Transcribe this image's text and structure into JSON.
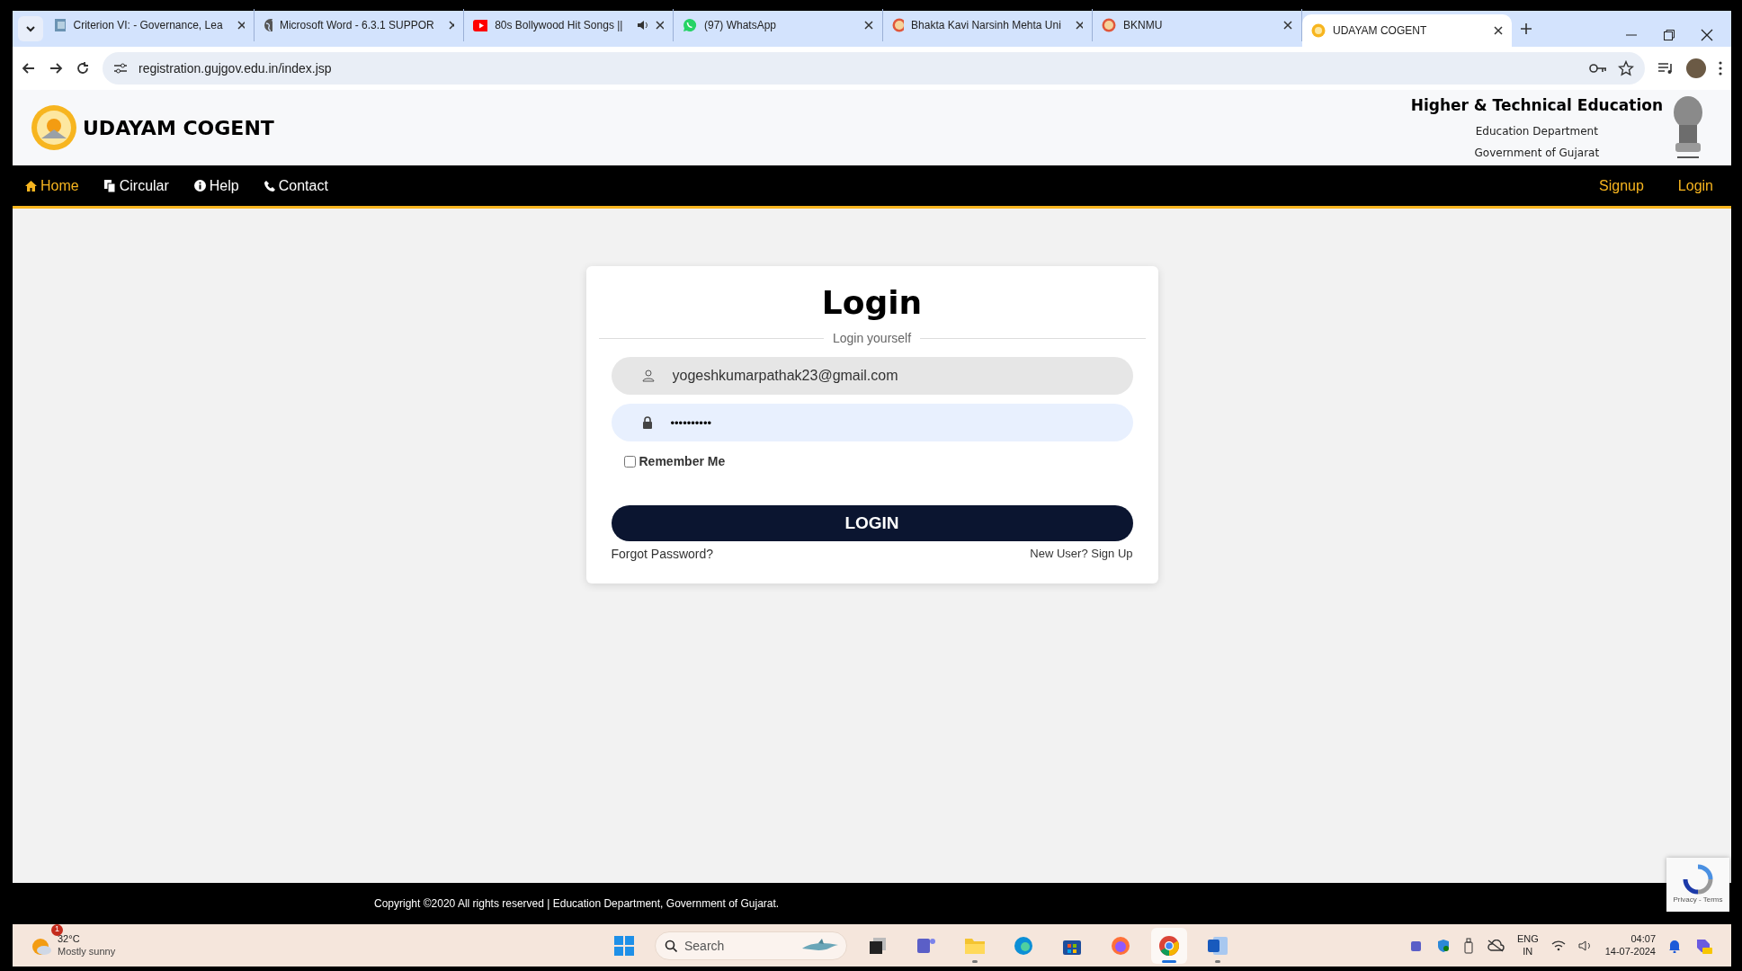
{
  "browser": {
    "tabs": [
      {
        "title": "Criterion VI: - Governance, Lea",
        "audio": false,
        "selected": false
      },
      {
        "title": "Microsoft Word - 6.3.1 SUPPOR",
        "audio": false,
        "selected": false
      },
      {
        "title": "80s Bollywood Hit Songs ||",
        "audio": true,
        "selected": false
      },
      {
        "title": "(97) WhatsApp",
        "audio": false,
        "selected": false
      },
      {
        "title": "Bhakta Kavi Narsinh Mehta Uni",
        "audio": false,
        "selected": false
      },
      {
        "title": "BKNMU",
        "audio": false,
        "selected": false
      },
      {
        "title": "UDAYAM COGENT",
        "audio": false,
        "selected": true
      }
    ],
    "url": "registration.gujgov.edu.in/index.jsp"
  },
  "header": {
    "brand": "UDAYAM COGENT",
    "org_title": "Higher & Technical Education",
    "org_dept": "Education Department",
    "org_gov": "Government of Gujarat"
  },
  "nav": {
    "items": [
      {
        "label": "Home",
        "selected": true
      },
      {
        "label": "Circular",
        "selected": false
      },
      {
        "label": "Help",
        "selected": false
      },
      {
        "label": "Contact",
        "selected": false
      }
    ],
    "right": [
      "Signup",
      "Login"
    ]
  },
  "login": {
    "title": "Login",
    "subtitle": "Login yourself",
    "email": "yogeshkumarpathak23@gmail.com",
    "password": "••••••••••",
    "remember": {
      "label": "Remember Me",
      "checked": false
    },
    "button": "LOGIN",
    "forgot": "Forgot Password?",
    "signup": "New User? Sign Up"
  },
  "footer": "Copyright ©2020 All rights reserved | Education Department, Government of Gujarat.",
  "recaptcha": "Privacy - Terms",
  "taskbar": {
    "weather": {
      "temp": "32°C",
      "desc": "Mostly sunny",
      "badge": "1"
    },
    "search": {
      "placeholder": "Search"
    },
    "apps": [
      {
        "kind": "start",
        "running": false,
        "active": false
      },
      {
        "kind": "taskview",
        "running": false,
        "active": false
      },
      {
        "kind": "teams",
        "running": false,
        "active": false
      },
      {
        "kind": "files",
        "running": true,
        "active": false
      },
      {
        "kind": "edge",
        "running": false,
        "active": false
      },
      {
        "kind": "store",
        "running": false,
        "active": false
      },
      {
        "kind": "firefox",
        "running": false,
        "active": false
      },
      {
        "kind": "chrome",
        "running": true,
        "active": true
      },
      {
        "kind": "word",
        "running": true,
        "active": false
      }
    ],
    "lang": "ENG",
    "region": "IN",
    "time": "04:07",
    "date": "14-07-2024"
  }
}
